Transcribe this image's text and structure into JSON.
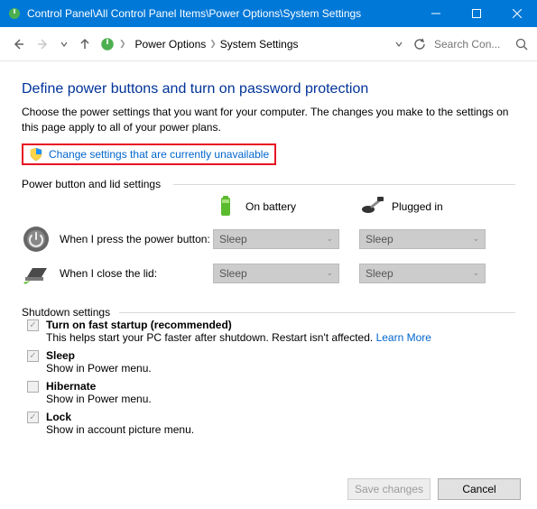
{
  "titlebar": {
    "title": "Control Panel\\All Control Panel Items\\Power Options\\System Settings"
  },
  "nav": {
    "crumb1": "Power Options",
    "crumb2": "System Settings",
    "search_placeholder": "Search Con..."
  },
  "page": {
    "heading": "Define power buttons and turn on password protection",
    "subtext": "Choose the power settings that you want for your computer. The changes you make to the settings on this page apply to all of your power plans.",
    "change_link": "Change settings that are currently unavailable"
  },
  "section1": {
    "legend": "Power button and lid settings",
    "col_battery": "On battery",
    "col_plugged": "Plugged in",
    "row_power_label": "When I press the power button:",
    "row_power_batt": "Sleep",
    "row_power_plug": "Sleep",
    "row_lid_label": "When I close the lid:",
    "row_lid_batt": "Sleep",
    "row_lid_plug": "Sleep"
  },
  "section2": {
    "legend": "Shutdown settings",
    "fast_startup_label": "Turn on fast startup (recommended)",
    "fast_startup_desc": "This helps start your PC faster after shutdown. Restart isn't affected. ",
    "learn_more": "Learn More",
    "sleep_label": "Sleep",
    "sleep_desc": "Show in Power menu.",
    "hibernate_label": "Hibernate",
    "hibernate_desc": "Show in Power menu.",
    "lock_label": "Lock",
    "lock_desc": "Show in account picture menu."
  },
  "footer": {
    "save": "Save changes",
    "cancel": "Cancel"
  }
}
